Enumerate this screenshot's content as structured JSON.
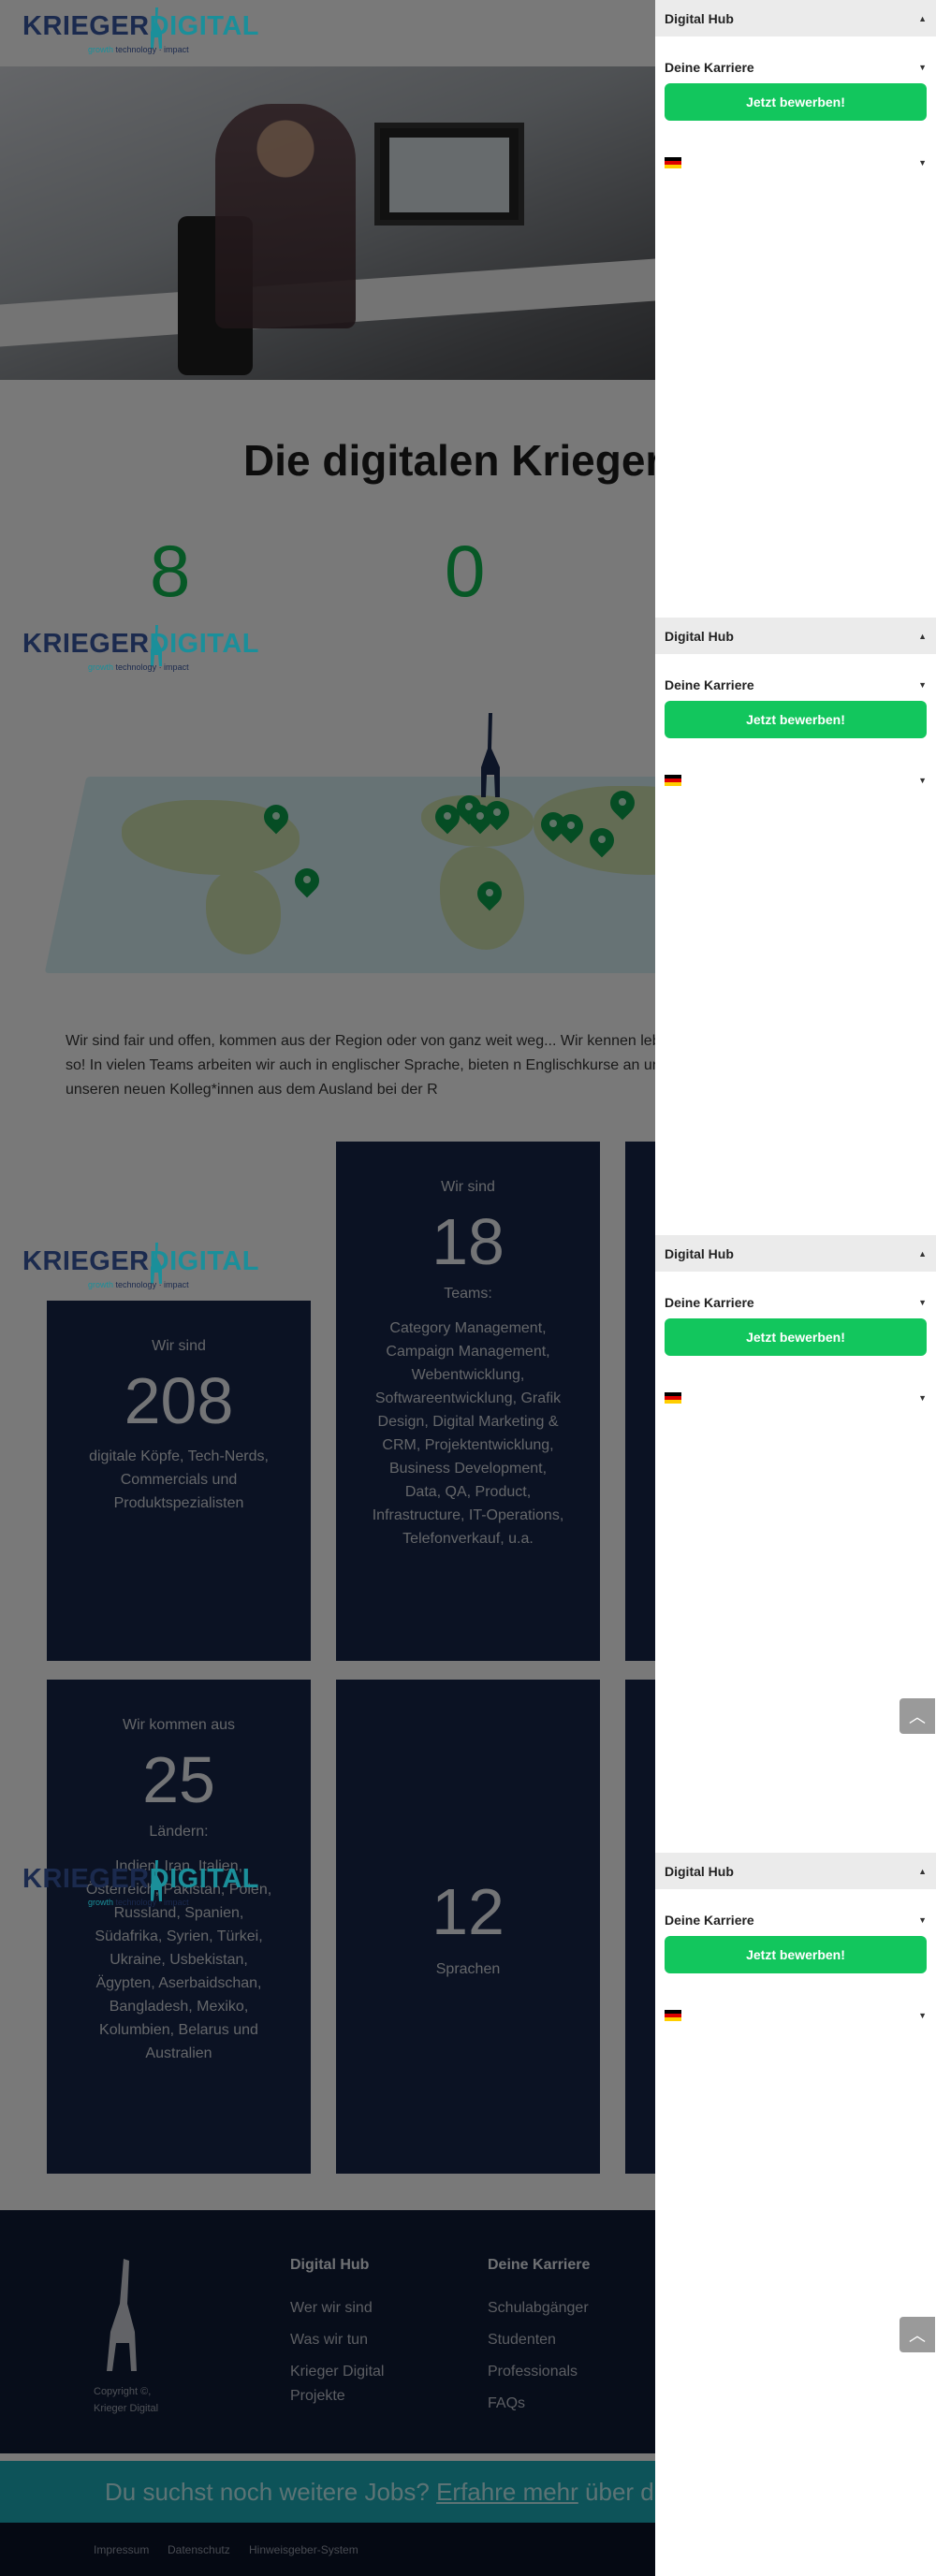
{
  "brand": {
    "word1": "KRIEGER",
    "word2": "DIGITAL",
    "tag_green": "growth",
    "tag_rest": "technology · impact"
  },
  "drawer": {
    "menu1": "Digital Hub",
    "menu1_caret": "▲",
    "menu2": "Deine Karriere",
    "menu2_caret": "▼",
    "cta": "Jetzt bewerben!",
    "lang_caret": "▼"
  },
  "headline": "Die digitalen Krieger",
  "counters": [
    "8",
    "0"
  ],
  "intro": "Wir sind fair und offen, kommen aus der Region oder von ganz weit weg... Wir kennen leben wir auch so! In vielen Teams arbeiten wir auch in englischer Sprache, bieten n Englischkurse an und helfen unseren neuen Kolleg*innen aus dem Ausland bei der R",
  "cards": {
    "heads_pre": "Wir sind",
    "heads_num": "208",
    "heads_txt": "digitale Köpfe, Tech-Nerds, Commercials und Produktspezialisten",
    "teams_pre": "Wir sind",
    "teams_num": "18",
    "teams_label": "Teams:",
    "teams_txt": "Category Management, Campaign Management, Webentwicklung, Softwareentwicklung, Grafik Design, Digital Marketing & CRM, Projektentwicklung, Business Development, Data, QA, Product, Infrastructure, IT-Operations, Telefonverkauf, u.a.",
    "countries_pre": "Wir kommen aus",
    "countries_num": "25",
    "countries_label": "Ländern:",
    "countries_txt": "Indien, Iran, Italien, Österreich, Pakistan, Polen, Russland, Spanien, Südafrika, Syrien, Türkei, Ukraine, Usbekistan, Ägypten, Aserbaidschan, Bangladesh, Mexiko, Kolumbien, Belarus und Australien",
    "lang_num": "12",
    "lang_txt": "Sprachen"
  },
  "footer": {
    "copyright": "Copyright ©,",
    "copyright_2": "Krieger Digital",
    "col1_head": "Digital Hub",
    "col1_links": [
      "Wer wir sind",
      "Was wir tun",
      "Krieger Digital",
      "Projekte"
    ],
    "col2_head": "Deine Karriere",
    "col2_links": [
      "Schulabgänger",
      "Studenten",
      "Professionals",
      "FAQs"
    ]
  },
  "jobs_bar": {
    "pre": "Du suchst noch weitere Jobs? ",
    "link": "Erfahre mehr",
    "post": " über die"
  },
  "legal": [
    "Impressum",
    "Datenschutz",
    "Hinweisgeber-System"
  ],
  "to_top": "︿",
  "colors": {
    "accent_green": "#12c65d",
    "navy": "#162447",
    "teal": "#1aa6b3"
  }
}
